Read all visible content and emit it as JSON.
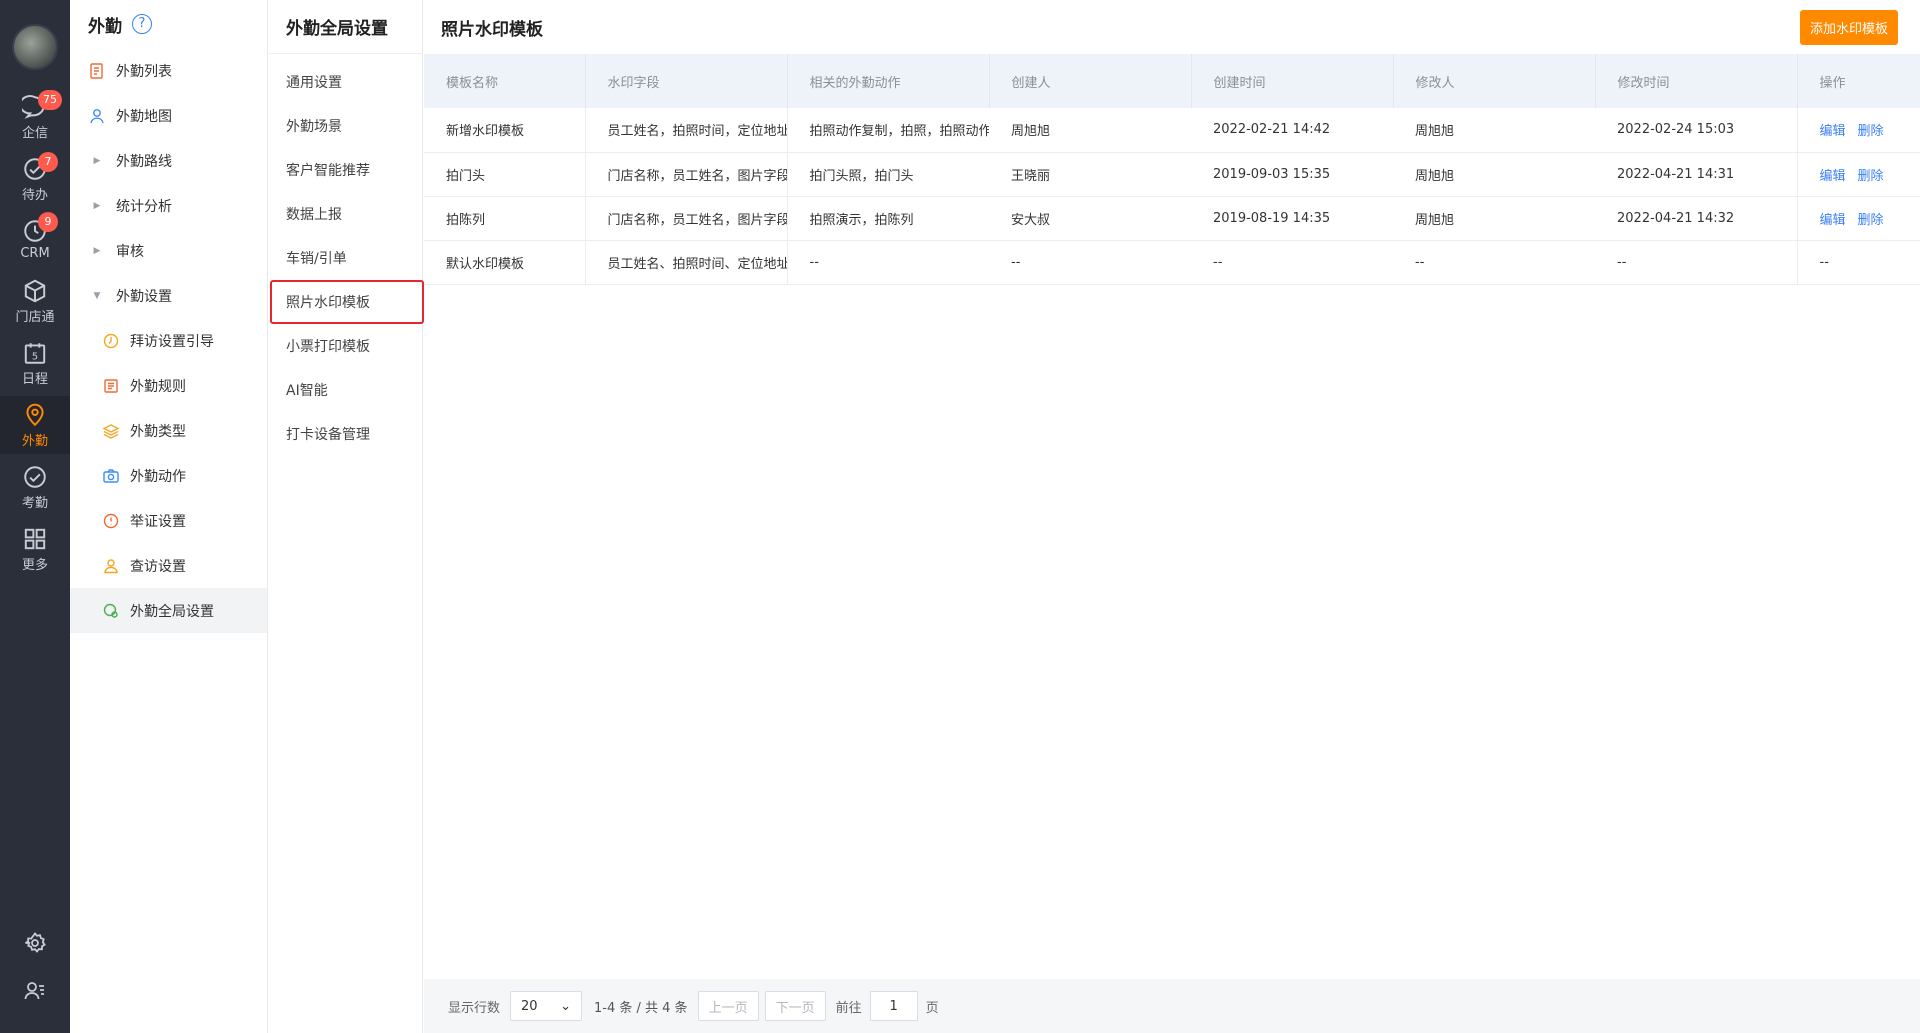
{
  "rail": {
    "items": [
      {
        "label": "企信",
        "icon": "chat-icon",
        "badge": "75"
      },
      {
        "label": "待办",
        "icon": "todo-check-icon",
        "badge": "7"
      },
      {
        "label": "CRM",
        "icon": "crm-clock-icon",
        "badge": "9"
      },
      {
        "label": "门店通",
        "icon": "cube-icon",
        "badge": ""
      },
      {
        "label": "日程",
        "icon": "calendar-icon",
        "badge": ""
      },
      {
        "label": "外勤",
        "icon": "location-pin-icon",
        "badge": ""
      },
      {
        "label": "考勤",
        "icon": "attendance-check-icon",
        "badge": ""
      },
      {
        "label": "更多",
        "icon": "grid-icon",
        "badge": ""
      }
    ],
    "calendar_day": "5"
  },
  "nav": {
    "title": "外勤",
    "help": "?",
    "items": [
      {
        "label": "外勤列表"
      },
      {
        "label": "外勤地图"
      },
      {
        "label": "外勤路线"
      },
      {
        "label": "统计分析"
      },
      {
        "label": "审核"
      },
      {
        "label": "外勤设置"
      },
      {
        "label": "拜访设置引导"
      },
      {
        "label": "外勤规则"
      },
      {
        "label": "外勤类型"
      },
      {
        "label": "外勤动作"
      },
      {
        "label": "举证设置"
      },
      {
        "label": "查访设置"
      },
      {
        "label": "外勤全局设置"
      }
    ]
  },
  "settings": {
    "title": "外勤全局设置",
    "items": [
      {
        "label": "通用设置"
      },
      {
        "label": "外勤场景"
      },
      {
        "label": "客户智能推荐"
      },
      {
        "label": "数据上报"
      },
      {
        "label": "车销/引单"
      },
      {
        "label": "照片水印模板"
      },
      {
        "label": "小票打印模板"
      },
      {
        "label": "AI智能"
      },
      {
        "label": "打卡设备管理"
      }
    ]
  },
  "main": {
    "title": "照片水印模板",
    "add_button": "添加水印模板",
    "columns": [
      "模板名称",
      "水印字段",
      "相关的外勤动作",
      "创建人",
      "创建时间",
      "修改人",
      "修改时间",
      "操作"
    ],
    "rows": [
      {
        "name": "新增水印模板",
        "fields": "员工姓名，拍照时间，定位地址，",
        "actions": "拍照动作复制，拍照，拍照动作",
        "creator": "周旭旭",
        "created": "2022-02-21 14:42",
        "modifier": "周旭旭",
        "modified": "2022-02-24 15:03",
        "op_edit": "编辑",
        "op_delete": "删除"
      },
      {
        "name": "拍门头",
        "fields": "门店名称，员工姓名，图片字段名",
        "actions": "拍门头照，拍门头",
        "creator": "王晓丽",
        "created": "2019-09-03 15:35",
        "modifier": "周旭旭",
        "modified": "2022-04-21 14:31",
        "op_edit": "编辑",
        "op_delete": "删除"
      },
      {
        "name": "拍陈列",
        "fields": "门店名称，员工姓名，图片字段名",
        "actions": "拍照演示，拍陈列",
        "creator": "安大叔",
        "created": "2019-08-19 14:35",
        "modifier": "周旭旭",
        "modified": "2022-04-21 14:32",
        "op_edit": "编辑",
        "op_delete": "删除"
      },
      {
        "name": "默认水印模板",
        "fields": "员工姓名、拍照时间、定位地址",
        "actions": "--",
        "creator": "--",
        "created": "--",
        "modifier": "--",
        "modified": "--",
        "op_edit": "--",
        "op_delete": ""
      }
    ]
  },
  "pagination": {
    "rows_label": "显示行数",
    "page_size": "20",
    "info": "1-4 条 / 共 4 条",
    "prev": "上一页",
    "next": "下一页",
    "goto": "前往",
    "page": "1",
    "unit": "页"
  },
  "colors": {
    "accent": "#ff8a00",
    "link": "#3a7ff6",
    "highlight_border": "#e8262e",
    "rail_bg": "#2b2f3a"
  }
}
